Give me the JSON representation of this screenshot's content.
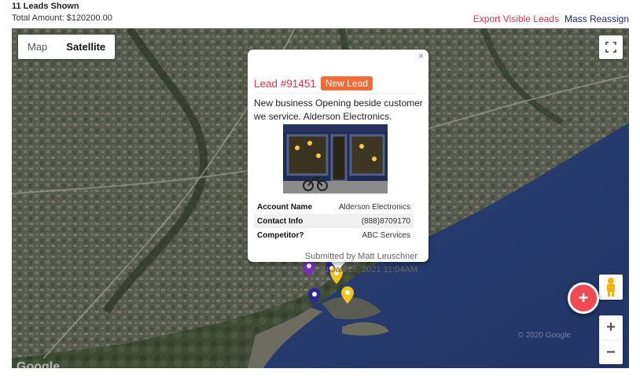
{
  "header": {
    "leads_shown": "11 Leads Shown",
    "total_amount": "Total Amount: $120200.00",
    "export_label": "Export Visible Leads",
    "reassign_label": "Mass Reassign"
  },
  "map": {
    "type_control": {
      "map_label": "Map",
      "satellite_label": "Satellite",
      "selected": "Satellite"
    },
    "zoom_in_label": "+",
    "zoom_out_label": "−",
    "fab_label": "+",
    "copyright": "© 2020 Google",
    "brand": "Google",
    "markers": [
      {
        "color": "#7b2fbe",
        "icon": "map-pin-icon"
      },
      {
        "color": "#2b2a8f",
        "icon": "map-pin-icon"
      },
      {
        "color": "#f3c51b",
        "icon": "map-pin-icon"
      },
      {
        "color": "#2b2a8f",
        "icon": "map-pin-icon"
      },
      {
        "color": "#f3c51b",
        "icon": "map-pin-icon"
      }
    ],
    "icons": {
      "fullscreen": "fullscreen-icon",
      "pegman": "pegman-icon",
      "close": "close-icon"
    }
  },
  "popup": {
    "lead_id": "Lead #91451",
    "badge": "New Lead",
    "description": "New business Opening beside customer we service. Alderson Electronics.",
    "photo_icon": "storefront-photo",
    "close_label": "×",
    "details": [
      {
        "label": "Account Name",
        "value": "Alderson Electronics"
      },
      {
        "label": "Contact Info",
        "value": "(888)8709170"
      },
      {
        "label": "Competitor?",
        "value": "ABC Services"
      }
    ],
    "submitted_by": "Submitted by Matt Leuschner",
    "submitted_at": "at Jan 18, 2021 11:04AM"
  },
  "colors": {
    "accent_red": "#e0334d",
    "badge_orange": "#f36a37",
    "link_navy": "#1b2a6b",
    "fab_red": "#f24a52"
  }
}
